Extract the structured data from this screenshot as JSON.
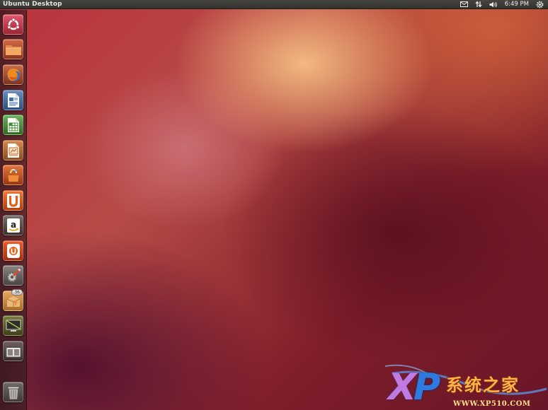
{
  "panel": {
    "title": "Ubuntu Desktop",
    "clock": "6:49 PM",
    "indicators": [
      "mail-icon",
      "network-icon",
      "volume-icon",
      "gear-icon"
    ]
  },
  "launcher": {
    "items": [
      {
        "name": "dash-home",
        "icon": "ubuntu-logo-icon"
      },
      {
        "name": "home-folder",
        "icon": "folder-icon"
      },
      {
        "name": "firefox",
        "icon": "firefox-icon"
      },
      {
        "name": "libreoffice-writer",
        "icon": "writer-icon"
      },
      {
        "name": "libreoffice-calc",
        "icon": "calc-icon"
      },
      {
        "name": "libreoffice-impress",
        "icon": "impress-icon"
      },
      {
        "name": "ubuntu-software-center",
        "icon": "software-center-icon"
      },
      {
        "name": "ubuntu-one",
        "icon": "ubuntu-one-icon"
      },
      {
        "name": "amazon",
        "icon": "amazon-icon"
      },
      {
        "name": "ubuntu-one-music",
        "icon": "ubuntu-one-music-icon"
      },
      {
        "name": "system-settings",
        "icon": "settings-icon"
      },
      {
        "name": "update-manager",
        "icon": "update-manager-icon",
        "badge": "36"
      },
      {
        "name": "workspace-switcher",
        "icon": "workspace-switcher-icon"
      },
      {
        "name": "show-desktop",
        "icon": "desktop-icon"
      },
      {
        "name": "trash",
        "icon": "trash-icon"
      }
    ]
  },
  "watermark": {
    "letters": "XP",
    "name": "系统之家",
    "url": "WWW.XP510.COM"
  }
}
